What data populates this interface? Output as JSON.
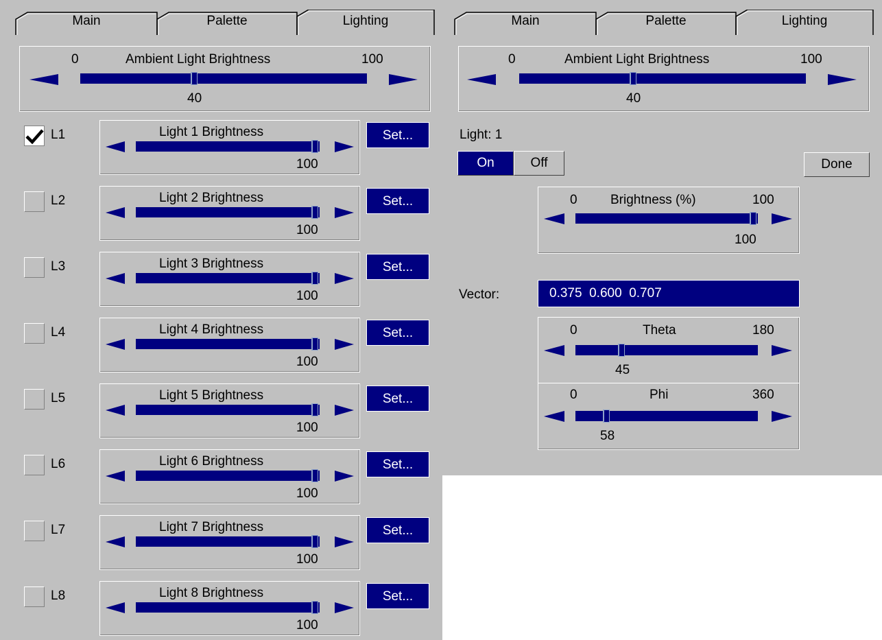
{
  "left": {
    "tabs": [
      {
        "label": "Main"
      },
      {
        "label": "Palette"
      },
      {
        "label": "Lighting"
      }
    ],
    "ambient": {
      "title": "Ambient Light Brightness",
      "min": "0",
      "max": "100",
      "value": "40"
    },
    "lights": [
      {
        "id": "L1",
        "checked": true,
        "title": "Light 1 Brightness",
        "value": "100",
        "set_label": "Set..."
      },
      {
        "id": "L2",
        "checked": false,
        "title": "Light 2 Brightness",
        "value": "100",
        "set_label": "Set..."
      },
      {
        "id": "L3",
        "checked": false,
        "title": "Light 3 Brightness",
        "value": "100",
        "set_label": "Set..."
      },
      {
        "id": "L4",
        "checked": false,
        "title": "Light 4 Brightness",
        "value": "100",
        "set_label": "Set..."
      },
      {
        "id": "L5",
        "checked": false,
        "title": "Light 5 Brightness",
        "value": "100",
        "set_label": "Set..."
      },
      {
        "id": "L6",
        "checked": false,
        "title": "Light 6 Brightness",
        "value": "100",
        "set_label": "Set..."
      },
      {
        "id": "L7",
        "checked": false,
        "title": "Light 7 Brightness",
        "value": "100",
        "set_label": "Set..."
      },
      {
        "id": "L8",
        "checked": false,
        "title": "Light 8 Brightness",
        "value": "100",
        "set_label": "Set..."
      }
    ]
  },
  "right": {
    "tabs": [
      {
        "label": "Main"
      },
      {
        "label": "Palette"
      },
      {
        "label": "Lighting"
      }
    ],
    "ambient": {
      "title": "Ambient Light Brightness",
      "min": "0",
      "max": "100",
      "value": "40"
    },
    "light_label": "Light: 1",
    "on_label": "On",
    "off_label": "Off",
    "selected": "On",
    "done_label": "Done",
    "brightness": {
      "title": "Brightness (%)",
      "min": "0",
      "max": "100",
      "value": "100"
    },
    "vector_label": "Vector:",
    "vector_value": "0.375  0.600  0.707",
    "theta": {
      "title": "Theta",
      "min": "0",
      "max": "180",
      "value": "45"
    },
    "phi": {
      "title": "Phi",
      "min": "0",
      "max": "360",
      "value": "58"
    }
  },
  "colors": {
    "panel": "#c0c0c0",
    "accent": "#000080",
    "highlight": "#ffffff",
    "shadow": "#808080"
  },
  "icons": {
    "slider_left": "left-arrow-icon",
    "slider_right": "right-arrow-icon",
    "check": "checkmark-icon"
  }
}
